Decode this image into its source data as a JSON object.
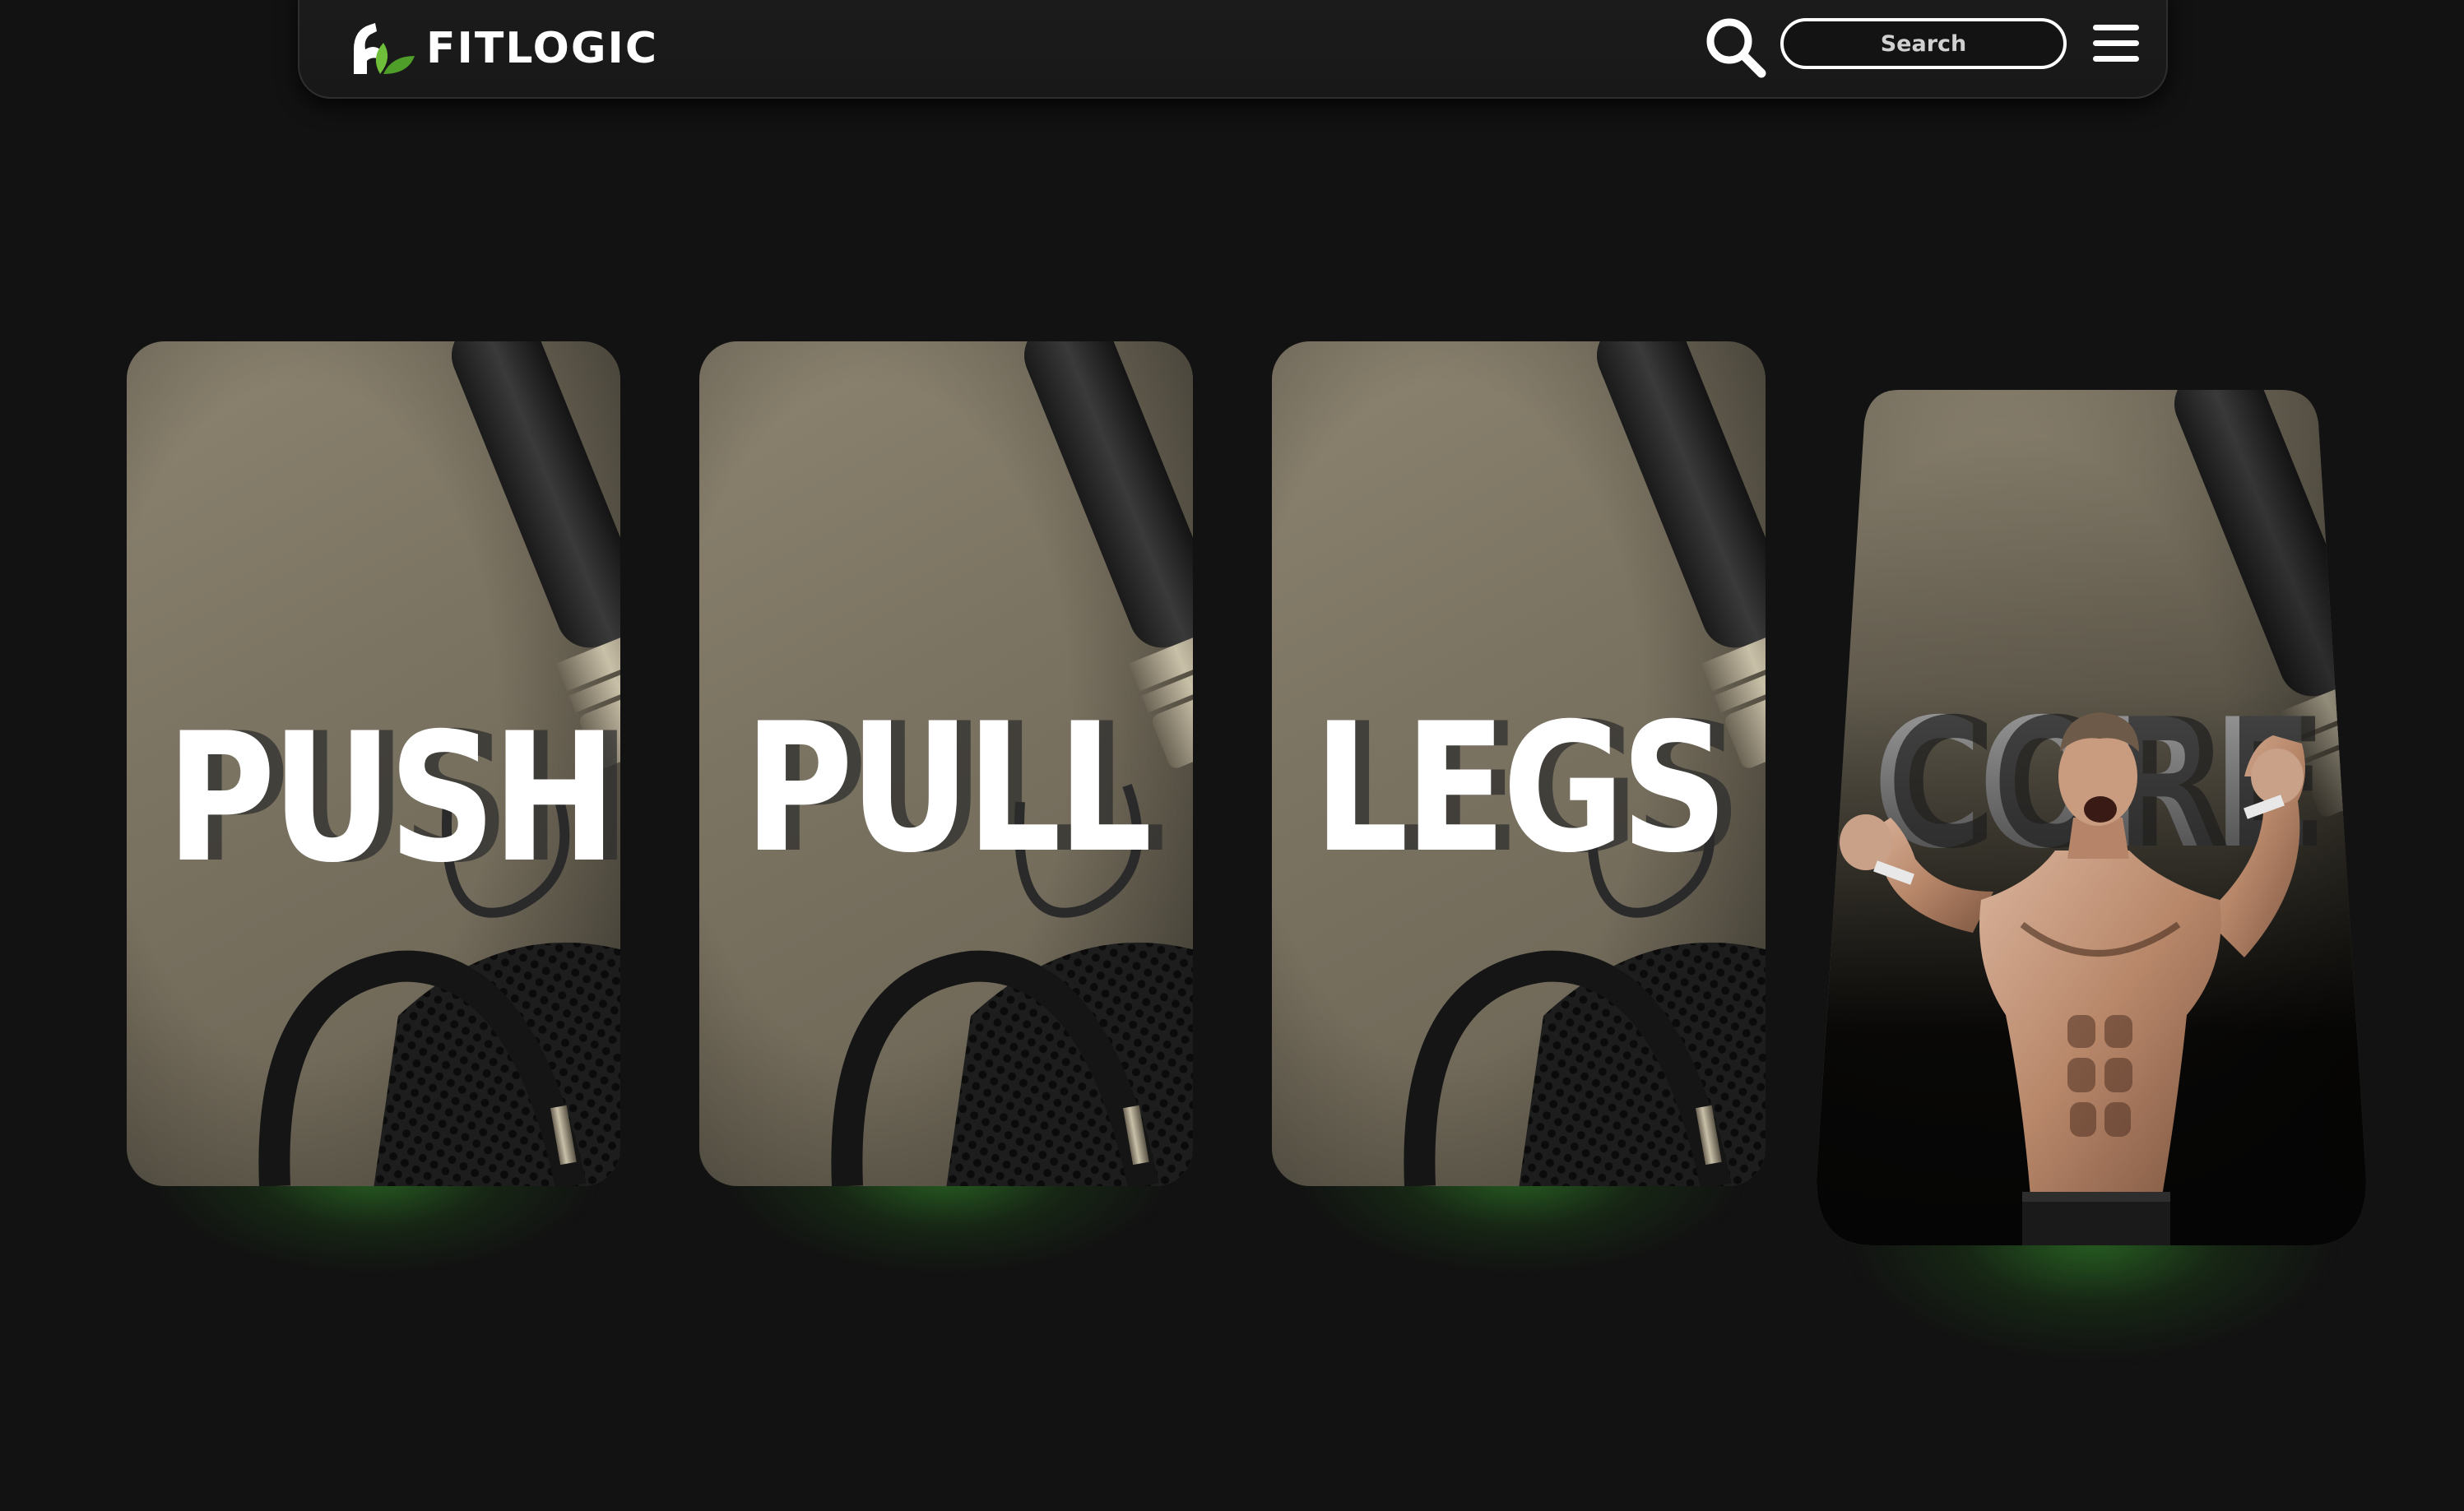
{
  "header": {
    "brand": "FITLOGIC",
    "logo_icon": "bicep-leaf-icon",
    "search_icon": "search-icon",
    "search_placeholder": "Search",
    "search_value": "",
    "menu_icon": "hamburger-menu-icon"
  },
  "cards": [
    {
      "title": "PUSH",
      "image": "gym-equipment-photo",
      "state": "default"
    },
    {
      "title": "PULL",
      "image": "gym-equipment-photo",
      "state": "default"
    },
    {
      "title": "LEGS",
      "image": "gym-equipment-photo",
      "state": "default"
    },
    {
      "title": "CORE",
      "image": "athlete-flexing-photo",
      "state": "hovered"
    }
  ],
  "colors": {
    "background": "#121212",
    "header": "#1a1a1a",
    "accent_green": "#3aa030",
    "leaf_green": "#6fbf3a",
    "text": "#ffffff"
  }
}
